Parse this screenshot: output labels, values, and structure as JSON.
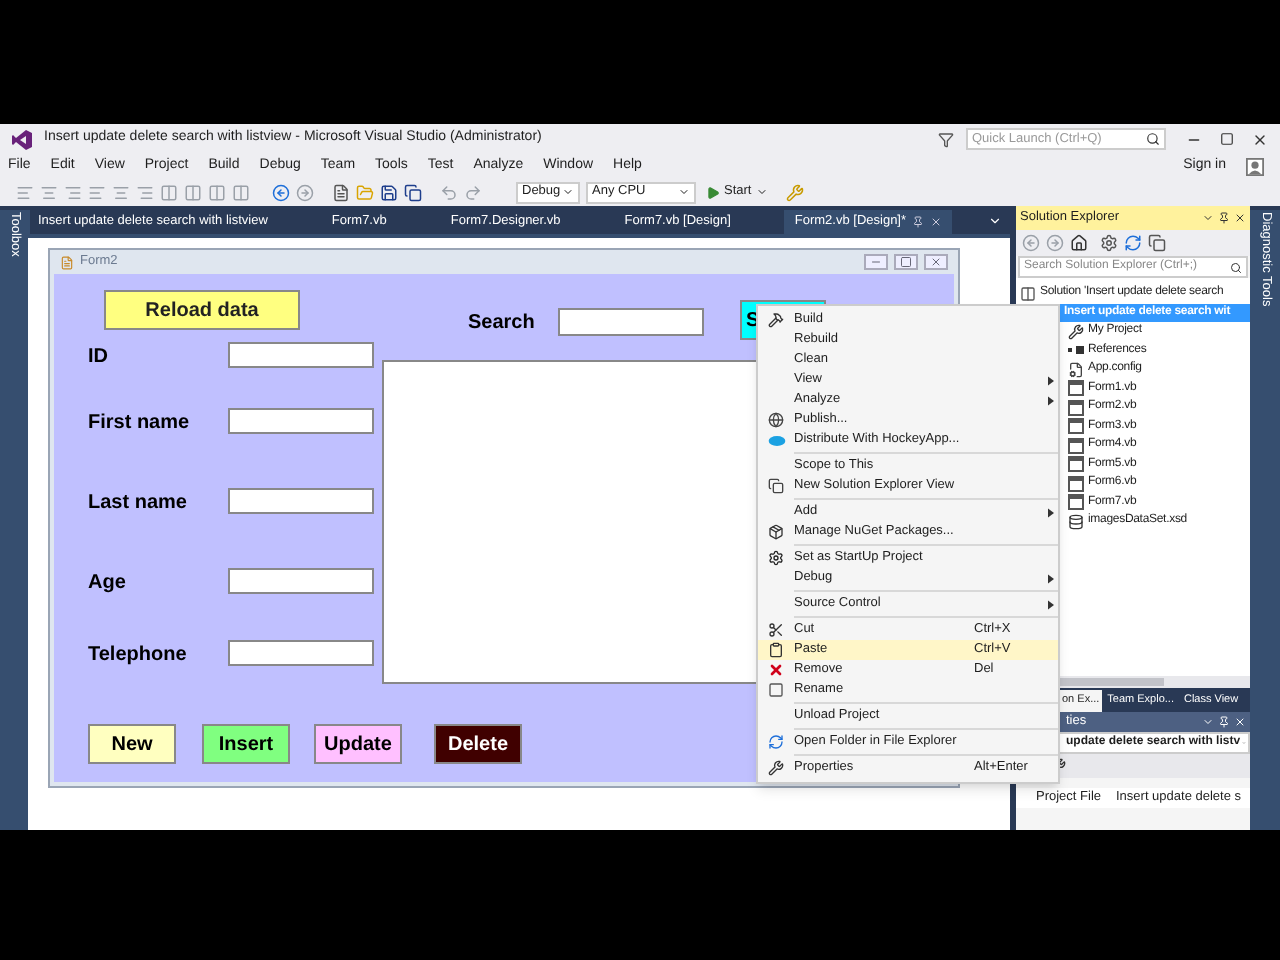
{
  "window": {
    "title": "Insert update delete search with listview - Microsoft Visual Studio (Administrator)",
    "quick_launch": {
      "placeholder": "Quick Launch (Ctrl+Q)"
    },
    "sign_in": "Sign in"
  },
  "menu": [
    "File",
    "Edit",
    "View",
    "Project",
    "Build",
    "Debug",
    "Team",
    "Tools",
    "Test",
    "Analyze",
    "Window",
    "Help"
  ],
  "toolbar": {
    "configuration": "Debug",
    "platform": "Any CPU",
    "start": "Start"
  },
  "side_tabs": {
    "left": "Toolbox",
    "right": "Diagnostic Tools"
  },
  "document_tabs": [
    {
      "label": "Insert update delete search with listview",
      "selected": false
    },
    {
      "label": "Form7.vb",
      "selected": false
    },
    {
      "label": "Form7.Designer.vb",
      "selected": false
    },
    {
      "label": "Form7.vb [Design]",
      "selected": false
    },
    {
      "label": "Form2.vb [Design]*",
      "selected": true
    }
  ],
  "form": {
    "title": "Form2",
    "reload_button": "Reload data",
    "search_label": "Search",
    "search_button": "S",
    "fields": [
      {
        "label": "ID"
      },
      {
        "label": "First name"
      },
      {
        "label": "Last name"
      },
      {
        "label": "Age"
      },
      {
        "label": "Telephone"
      }
    ],
    "buttons": [
      {
        "label": "New",
        "color": "#ffffc0"
      },
      {
        "label": "Insert",
        "color": "#80ff80"
      },
      {
        "label": "Update",
        "color": "#ffc0ff"
      },
      {
        "label": "Delete",
        "color": "#400000"
      }
    ]
  },
  "context_menu": [
    {
      "kind": "build",
      "label": "Build",
      "submenu": false,
      "selected": false
    },
    {
      "kind": "plain",
      "label": "Rebuild",
      "submenu": false,
      "selected": false
    },
    {
      "kind": "plain",
      "label": "Clean",
      "submenu": false,
      "selected": false
    },
    {
      "kind": "plain",
      "label": "View",
      "submenu": true,
      "selected": false
    },
    {
      "kind": "plain",
      "label": "Analyze",
      "submenu": true,
      "selected": false
    },
    {
      "kind": "publish",
      "label": "Publish...",
      "submenu": false,
      "selected": false
    },
    {
      "kind": "distribute",
      "label": "Distribute With HockeyApp...",
      "submenu": false,
      "selected": false
    },
    {
      "kind": "separator"
    },
    {
      "kind": "plain",
      "label": "Scope to This",
      "submenu": false,
      "selected": false
    },
    {
      "kind": "newview",
      "label": "New Solution Explorer View",
      "submenu": false,
      "selected": false
    },
    {
      "kind": "separator"
    },
    {
      "kind": "plain",
      "label": "Add",
      "submenu": true,
      "selected": false
    },
    {
      "kind": "nuget",
      "label": "Manage NuGet Packages...",
      "submenu": false,
      "selected": false
    },
    {
      "kind": "separator"
    },
    {
      "kind": "startup",
      "label": "Set as StartUp Project",
      "submenu": false,
      "selected": false
    },
    {
      "kind": "plain",
      "label": "Debug",
      "submenu": true,
      "selected": false
    },
    {
      "kind": "separator"
    },
    {
      "kind": "plain",
      "label": "Source Control",
      "submenu": true,
      "selected": false
    },
    {
      "kind": "separator"
    },
    {
      "kind": "cut",
      "label": "Cut",
      "shortcut": "Ctrl+X",
      "submenu": false,
      "selected": false
    },
    {
      "kind": "paste",
      "label": "Paste",
      "shortcut": "Ctrl+V",
      "submenu": false,
      "selected": true
    },
    {
      "kind": "remove",
      "label": "Remove",
      "shortcut": "Del",
      "submenu": false,
      "selected": false
    },
    {
      "kind": "rename",
      "label": "Rename",
      "submenu": false,
      "selected": false
    },
    {
      "kind": "separator"
    },
    {
      "kind": "plain",
      "label": "Unload Project",
      "submenu": false,
      "selected": false
    },
    {
      "kind": "separator"
    },
    {
      "kind": "openfolder",
      "label": "Open Folder in File Explorer",
      "submenu": false,
      "selected": false
    },
    {
      "kind": "separator"
    },
    {
      "kind": "properties",
      "label": "Properties",
      "shortcut": "Alt+Enter",
      "submenu": false,
      "selected": false
    }
  ],
  "solution_explorer": {
    "title": "Solution Explorer",
    "search": {
      "placeholder": "Search Solution Explorer (Ctrl+;)"
    },
    "tree": [
      {
        "kind": "solution",
        "label": "Solution 'Insert update delete search",
        "selected": false,
        "children": [
          {
            "kind": "project",
            "label": "Insert update delete search wit",
            "selected": true,
            "children": [
              {
                "kind": "myproject",
                "label": "My Project",
                "selected": false
              },
              {
                "kind": "references",
                "label": "References",
                "selected": false
              },
              {
                "kind": "config",
                "label": "App.config",
                "selected": false
              },
              {
                "kind": "form",
                "label": "Form1.vb",
                "selected": false
              },
              {
                "kind": "form",
                "label": "Form2.vb",
                "selected": false
              },
              {
                "kind": "form",
                "label": "Form3.vb",
                "selected": false
              },
              {
                "kind": "form",
                "label": "Form4.vb",
                "selected": false
              },
              {
                "kind": "form",
                "label": "Form5.vb",
                "selected": false
              },
              {
                "kind": "form",
                "label": "Form6.vb",
                "selected": false
              },
              {
                "kind": "form",
                "label": "Form7.vb",
                "selected": false
              },
              {
                "kind": "dataset",
                "label": "imagesDataSet.xsd",
                "selected": false
              }
            ]
          }
        ]
      }
    ]
  },
  "bottom_tabs": [
    {
      "label": "on Ex...",
      "selected": true
    },
    {
      "label": "Team Explo...",
      "selected": false
    },
    {
      "label": "Class View",
      "selected": false
    }
  ],
  "properties": {
    "title": "ties",
    "object": "update delete search with listv",
    "rows": [
      {
        "name": "Project File",
        "value": "Insert update delete s"
      }
    ]
  }
}
